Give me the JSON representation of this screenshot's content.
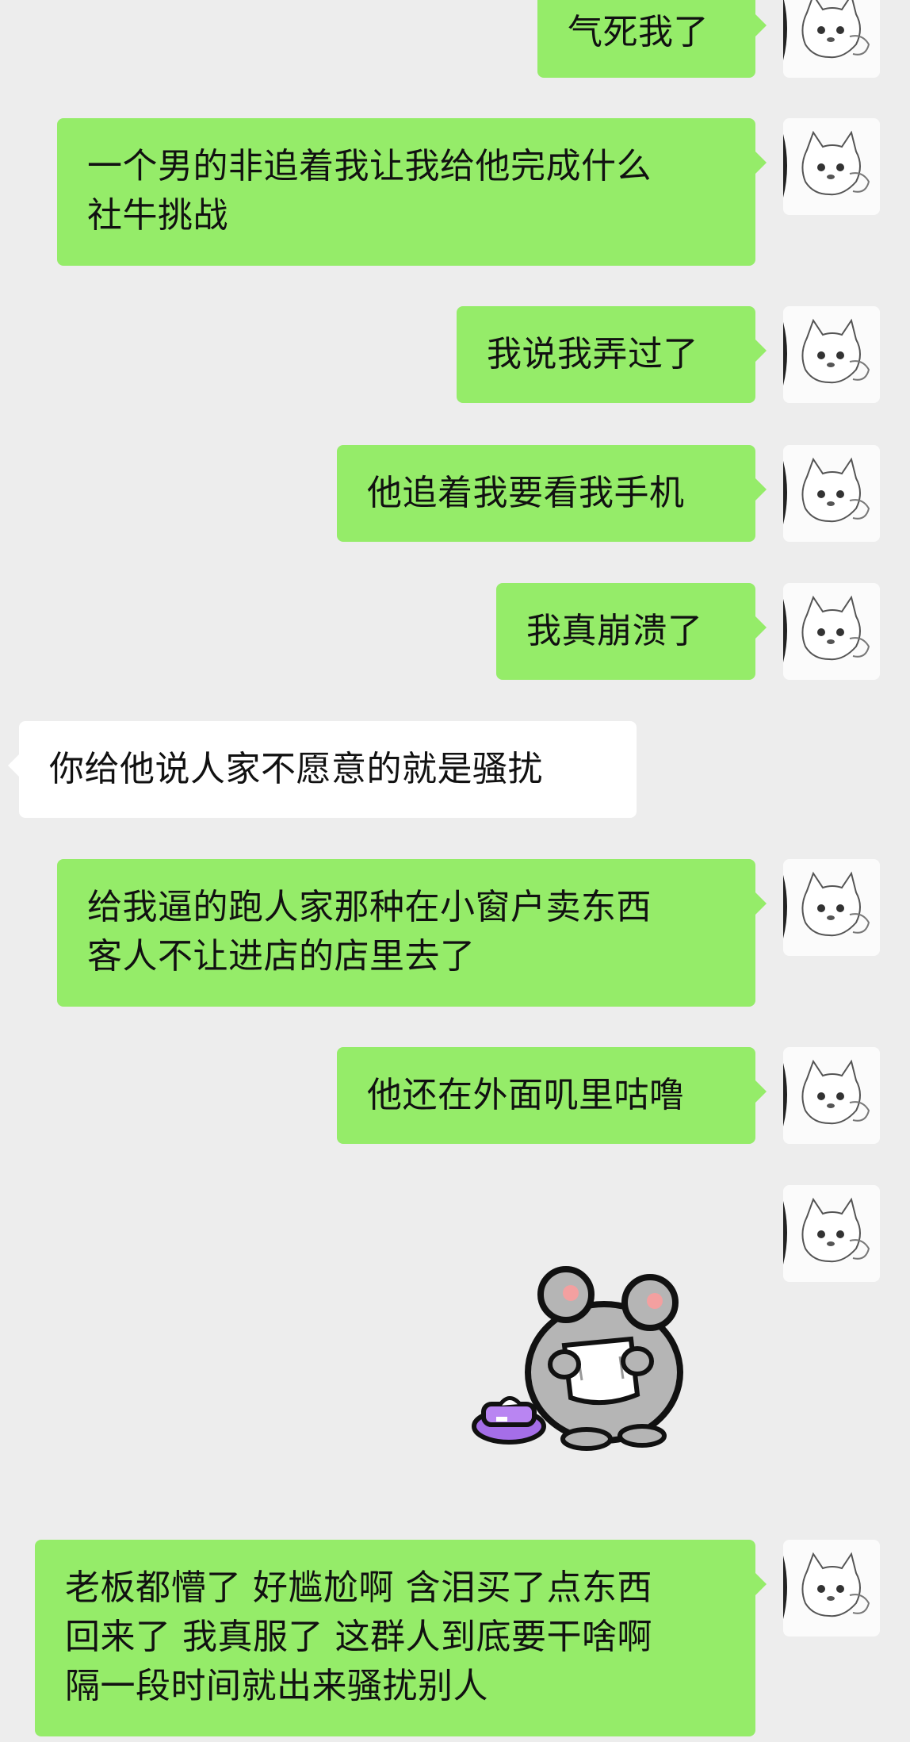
{
  "messages": [
    {
      "side": "out",
      "text": "气死我了"
    },
    {
      "side": "out",
      "text": "一个男的非追着我让我给他完成什么\n社牛挑战"
    },
    {
      "side": "out",
      "text": "我说我弄过了"
    },
    {
      "side": "out",
      "text": "他追着我要看我手机"
    },
    {
      "side": "out",
      "text": "我真崩溃了"
    },
    {
      "side": "in",
      "text": "你给他说人家不愿意的就是骚扰"
    },
    {
      "side": "out",
      "text": "给我逼的跑人家那种在小窗户卖东西\n客人不让进店的店里去了"
    },
    {
      "side": "out",
      "text": "他还在外面叽里咕噜"
    },
    {
      "side": "out",
      "type": "sticker",
      "sticker": "crying-mouse-tissue-sticker"
    },
    {
      "side": "out",
      "text": "老板都懵了 好尴尬啊 含泪买了点东西\n回来了 我真服了 这群人到底要干啥啊\n隔一段时间就出来骚扰别人"
    }
  ],
  "colors": {
    "background": "#ededed",
    "outgoing_bubble": "#95ec69",
    "incoming_bubble": "#ffffff"
  }
}
